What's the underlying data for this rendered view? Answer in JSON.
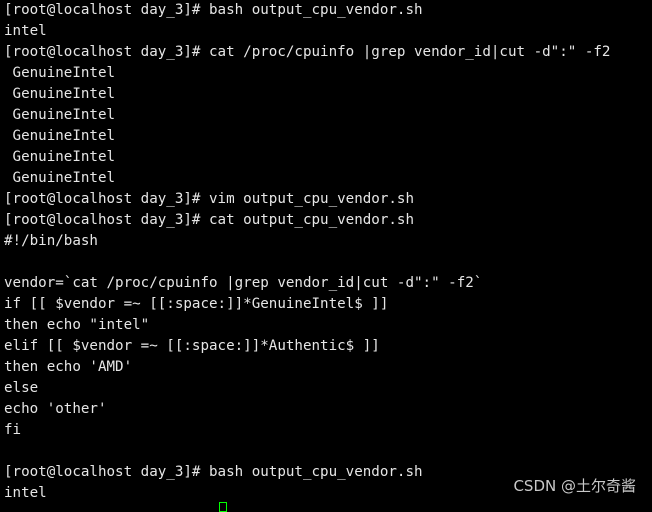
{
  "terminal": {
    "lines": [
      "[root@localhost day_3]# bash output_cpu_vendor.sh",
      "intel",
      "[root@localhost day_3]# cat /proc/cpuinfo |grep vendor_id|cut -d\":\" -f2",
      " GenuineIntel",
      " GenuineIntel",
      " GenuineIntel",
      " GenuineIntel",
      " GenuineIntel",
      " GenuineIntel",
      "[root@localhost day_3]# vim output_cpu_vendor.sh",
      "[root@localhost day_3]# cat output_cpu_vendor.sh",
      "#!/bin/bash",
      "",
      "vendor=`cat /proc/cpuinfo |grep vendor_id|cut -d\":\" -f2`",
      "if [[ $vendor =~ [[:space:]]*GenuineIntel$ ]]",
      "then echo \"intel\"",
      "elif [[ $vendor =~ [[:space:]]*Authentic$ ]]",
      "then echo 'AMD'",
      "else",
      "echo 'other'",
      "fi",
      "",
      "[root@localhost day_3]# bash output_cpu_vendor.sh",
      "intel"
    ],
    "colors": {
      "background": "#000000",
      "foreground": "#e6e6e6",
      "cursor": "#00ff00"
    }
  },
  "watermark": {
    "text": "CSDN @土尔奇酱"
  }
}
